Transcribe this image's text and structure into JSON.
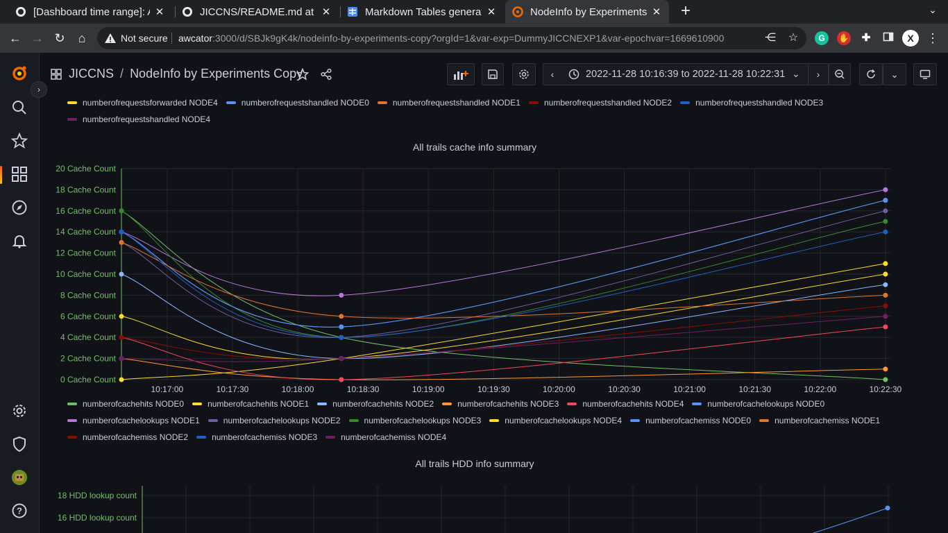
{
  "browser": {
    "tabs": [
      {
        "title": "[Dashboard time range]: A",
        "icon": "github-icon"
      },
      {
        "title": "JICCNS/README.md at m",
        "icon": "github-icon"
      },
      {
        "title": "Markdown Tables generat",
        "icon": "table-icon"
      },
      {
        "title": "NodeInfo by Experiments",
        "icon": "grafana-icon",
        "active": true
      }
    ],
    "new_tab": "+",
    "not_secure": "Not secure",
    "url_host": "awcator",
    "url_rest": ":3000/d/SBJk9gK4k/nodeinfo-by-experiments-copy?orgId=1&var-exp=DummyJICCNEXP1&var-epochvar=1669610900",
    "profile_initial": "X"
  },
  "header": {
    "folder": "JICCNS",
    "separator": "/",
    "title": "NodeInfo by Experiments Copy",
    "time_from": "2022-11-28 10:16:39",
    "time_to_word": "to",
    "time_to": "2022-11-28 10:22:31"
  },
  "top_legend": [
    {
      "name": "numberofrequestsforwarded NODE4",
      "color": "#fade2a"
    },
    {
      "name": "numberofrequestshandled NODE0",
      "color": "#5794f2"
    },
    {
      "name": "numberofrequestshandled NODE1",
      "color": "#e0752d"
    },
    {
      "name": "numberofrequestshandled NODE2",
      "color": "#890f02"
    },
    {
      "name": "numberofrequestshandled NODE3",
      "color": "#1f60c4"
    },
    {
      "name": "numberofrequestshandled NODE4",
      "color": "#6d1f62"
    }
  ],
  "chart_data": [
    {
      "type": "line",
      "title": "All trails cache info summary",
      "xlabel": "",
      "ylabel": "",
      "y_unit": "Cache Count",
      "ylim": [
        0,
        20
      ],
      "y_ticks": [
        "0 Cache Count",
        "2 Cache Count",
        "4 Cache Count",
        "6 Cache Count",
        "8 Cache Count",
        "10 Cache Count",
        "12 Cache Count",
        "14 Cache Count",
        "16 Cache Count",
        "18 Cache Count",
        "20 Cache Count"
      ],
      "x_ticks": [
        "10:17:00",
        "10:17:30",
        "10:18:00",
        "10:18:30",
        "10:19:00",
        "10:19:30",
        "10:20:00",
        "10:20:30",
        "10:21:00",
        "10:21:30",
        "10:22:00",
        "10:22:30"
      ],
      "x": [
        "10:16:39",
        "10:18:20",
        "10:22:30"
      ],
      "grid": true,
      "legend_position": "bottom",
      "series": [
        {
          "name": "numberofcachehits NODE0",
          "color": "#73bf69",
          "values": [
            16,
            4,
            0
          ]
        },
        {
          "name": "numberofcachehits NODE1",
          "color": "#fade2a",
          "values": [
            0,
            2,
            11
          ]
        },
        {
          "name": "numberofcachehits NODE2",
          "color": "#8ab8ff",
          "values": [
            10,
            2,
            9
          ]
        },
        {
          "name": "numberofcachehits NODE3",
          "color": "#ff9830",
          "values": [
            2,
            0,
            1
          ]
        },
        {
          "name": "numberofcachehits NODE4",
          "color": "#f2495c",
          "values": [
            4,
            0,
            5
          ]
        },
        {
          "name": "numberofcachelookups NODE0",
          "color": "#5794f2",
          "values": [
            14,
            5,
            17
          ]
        },
        {
          "name": "numberofcachelookups NODE1",
          "color": "#b877d9",
          "values": [
            14,
            8,
            18
          ]
        },
        {
          "name": "numberofcachelookups NODE2",
          "color": "#705da0",
          "values": [
            13,
            4,
            16
          ]
        },
        {
          "name": "numberofcachelookups NODE3",
          "color": "#37872d",
          "values": [
            16,
            4,
            15
          ]
        },
        {
          "name": "numberofcachelookups NODE4",
          "color": "#fade2a",
          "values": [
            6,
            2,
            10
          ]
        },
        {
          "name": "numberofcachemiss NODE0",
          "color": "#5794f2",
          "values": [
            14,
            5,
            17
          ]
        },
        {
          "name": "numberofcachemiss NODE1",
          "color": "#e0752d",
          "values": [
            13,
            6,
            8
          ]
        },
        {
          "name": "numberofcachemiss NODE2",
          "color": "#890f02",
          "values": [
            4,
            2,
            7
          ]
        },
        {
          "name": "numberofcachemiss NODE3",
          "color": "#1f60c4",
          "values": [
            14,
            4,
            14
          ]
        },
        {
          "name": "numberofcachemiss NODE4",
          "color": "#6d1f62",
          "values": [
            2,
            2,
            6
          ]
        }
      ]
    },
    {
      "type": "line",
      "title": "All trails HDD info summary",
      "xlabel": "",
      "ylabel": "",
      "y_unit": "HDD lookup count",
      "y_ticks_visible": [
        "16 HDD lookup count",
        "18 HDD lookup count"
      ],
      "grid": true
    }
  ]
}
